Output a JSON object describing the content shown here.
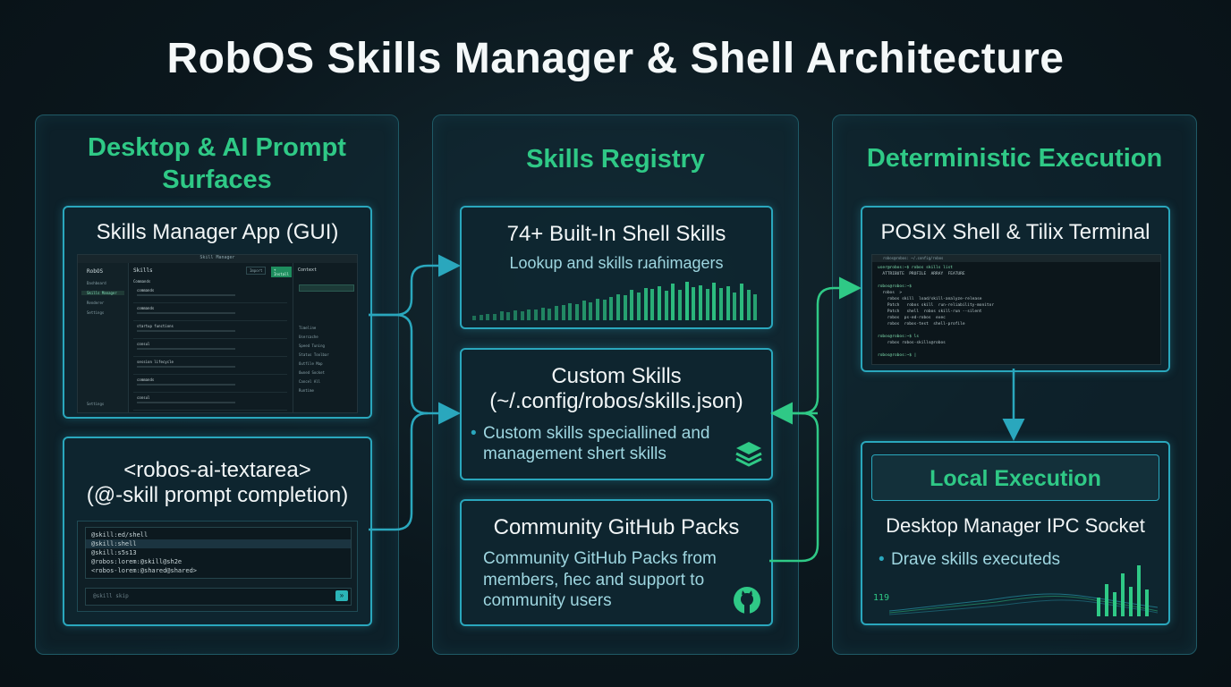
{
  "title": "RobOS Skills Manager & Shell Architecture",
  "columns": {
    "left": {
      "title_line1": "Desktop & AI Prompt",
      "title_line2": "Surfaces",
      "gui_card": {
        "title": "Skills Manager App (GUI)",
        "window_title": "Skill Manager",
        "brand": "RobOS",
        "sidebar": [
          "Dashboard",
          "Skills Manager",
          "Renderer",
          "Settings"
        ],
        "sidebar_footer": "Settings",
        "header": "Skills",
        "btn_primary": "+ Install",
        "btn_secondary": "Import",
        "section_label": "Commands",
        "items": [
          "commands",
          "commands",
          "startup functions",
          "consul",
          "session lifecycle",
          "commands",
          "consul"
        ],
        "right_panel_title": "Context",
        "right_panel_rows": [
          "Timeline",
          "Usercache",
          "Speed Tuning",
          "Status Toolbar",
          "Outfile Map",
          "Owned Socket",
          "Cancel All",
          "Runtime"
        ]
      },
      "textarea_card": {
        "title_line1": "<robos-ai-textarea>",
        "title_line2": "(@-skill prompt completion)",
        "lines": [
          "@skill:ed/shell",
          "@skill:shell",
          "@skill:s5s13",
          "@robos:lorem:@skill@sh2e",
          "<robos-lorem:@shared@shared>"
        ],
        "placeholder": "@skill skip"
      }
    },
    "middle": {
      "title": "Skills Registry",
      "builtin": {
        "title": "74+ Built-In Shell Skills",
        "subtitle": "Lookup and skills rɹaɦimagers",
        "bar_heights": [
          0.1,
          0.12,
          0.15,
          0.14,
          0.2,
          0.18,
          0.22,
          0.2,
          0.26,
          0.25,
          0.3,
          0.28,
          0.33,
          0.35,
          0.4,
          0.38,
          0.45,
          0.42,
          0.5,
          0.48,
          0.55,
          0.6,
          0.58,
          0.7,
          0.65,
          0.75,
          0.72,
          0.8,
          0.68,
          0.85,
          0.7,
          0.9,
          0.78,
          0.82,
          0.72,
          0.88,
          0.74,
          0.8,
          0.65,
          0.85,
          0.7,
          0.6
        ]
      },
      "custom": {
        "title_line1": "Custom Skills",
        "title_line2": "(~/.config/robos/skills.json)",
        "bullet_marker": "•",
        "desc_line1": "Custom skills speciallined and",
        "desc_line2": "management shert skills",
        "icon": "stack-layers-icon"
      },
      "community": {
        "title": "Community GitHub Packs",
        "desc_line1": "Community GitHub Packs from",
        "desc_line2": "members, ɦec and support to",
        "desc_line3": "community users",
        "icon": "github-icon"
      }
    },
    "right": {
      "title": "Deterministic Execution",
      "terminal": {
        "title": "POSIX Shell & Tilix Terminal",
        "window_title": "robos@robos: ~/.config/robos",
        "lines": [
          "user@robos:~$ robos skills list",
          "  ATTRIBUTE  PROFILE  ARRAY  FEATURE",
          "",
          "robos@robos:~$",
          "  robos  > ",
          "    robos skill  load/skill-analyze-release",
          "    Patch   robos skill  run-reliability-monitor",
          "    Patch   shell  robos skill-run --silent",
          "    robos  ps-ed-robos  exec",
          "    robos  robos-test  shell-profile",
          "",
          "robos@robos:~$ ls",
          "    robos robos-skills@robos",
          "",
          "robos@robos:~$ |"
        ]
      },
      "local": {
        "header": "Local Execution",
        "title": "Desktop Manager IPC Socket",
        "bullet_marker": "•",
        "bullet": "Drave skills executeds",
        "spark_label": "119"
      }
    }
  },
  "colors": {
    "accent_green": "#2fc986",
    "accent_cyan": "#2aa7bd",
    "bg": "#0b171d"
  }
}
